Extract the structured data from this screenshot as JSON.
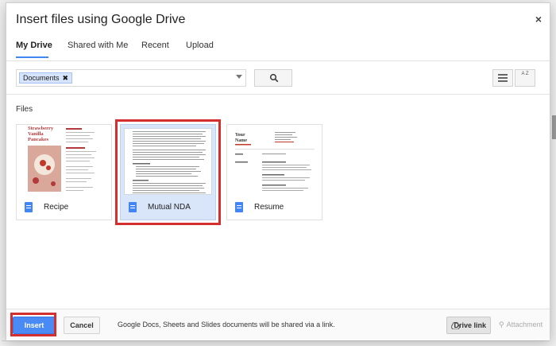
{
  "dialog": {
    "title": "Insert files using Google Drive",
    "close_glyph": "×"
  },
  "tabs": [
    {
      "label": "My Drive",
      "active": true
    },
    {
      "label": "Shared with Me",
      "active": false
    },
    {
      "label": "Recent",
      "active": false
    },
    {
      "label": "Upload",
      "active": false
    }
  ],
  "search": {
    "chip_label": "Documents",
    "chip_remove": "✖",
    "search_icon": "search-icon",
    "list_view_icon": "list-view-icon",
    "sort_icon": "sort-az-icon",
    "sort_glyph": "A Z"
  },
  "files_section": {
    "label": "Files",
    "files": [
      {
        "name": "Recipe",
        "icon": "google-doc-icon",
        "selected": false,
        "preview_title": "Strawberry Vanilla Pancakes"
      },
      {
        "name": "Mutual NDA",
        "icon": "google-doc-icon",
        "selected": true
      },
      {
        "name": "Resume",
        "icon": "google-doc-icon",
        "selected": false,
        "preview_title": "Your Name"
      }
    ]
  },
  "footer": {
    "insert_label": "Insert",
    "cancel_label": "Cancel",
    "note": "Google Docs, Sheets and Slides documents will be shared via a link.",
    "drive_link_label": "Drive link",
    "attachment_label": "Attachment"
  },
  "colors": {
    "accent": "#4285f4",
    "primary_button": "#4a8af4",
    "highlight": "#d32f2f",
    "selected_card": "#d9e6f9"
  }
}
